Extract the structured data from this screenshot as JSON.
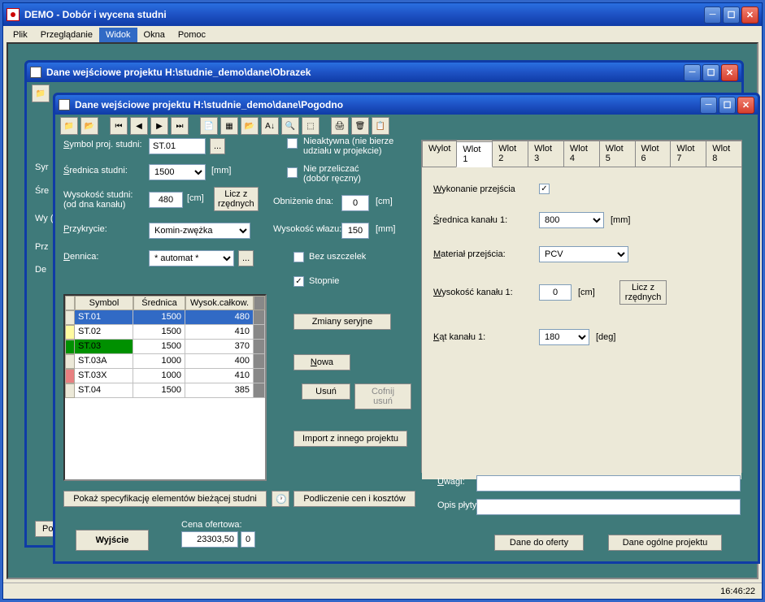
{
  "app": {
    "title": "DEMO - Dobór i wycena studni",
    "statusTime": "16:46:22"
  },
  "menu": [
    "Plik",
    "Przeglądanie",
    "Widok",
    "Okna",
    "Pomoc"
  ],
  "backWindow": {
    "title": "Dane wejściowe projektu H:\\studnie_demo\\dane\\Obrazek",
    "peekLabels": [
      "Syr",
      "Śre",
      "Wy\n(od",
      "Prz",
      "De"
    ]
  },
  "frontWindow": {
    "title": "Dane wejściowe projektu H:\\studnie_demo\\dane\\Pogodno"
  },
  "form": {
    "symbolLabel": "Symbol proj. studni:",
    "symbolValue": "ST.01",
    "srednicaLabel": "Średnica studni:",
    "srednicaValue": "1500",
    "srednicaUnit": "[mm]",
    "wysokoscLabel": "Wysokość studni:\n(od dna kanału)",
    "wysokoscValue": "480",
    "wysokoscUnit": "[cm]",
    "liczBtn": "Licz z\nrzędnych",
    "przykrycieLabel": "Przykrycie:",
    "przykrycieValue": "Komin-zwężka",
    "dennicaLabel": "Dennica:",
    "dennicaValue": "* automat *",
    "nieaktywnaLabel": "Nieaktywna (nie bierze\nudziału w projekcie)",
    "niePrzeliczacLabel": "Nie przeliczać\n(dobór ręczny)",
    "obnizenieLabel": "Obniżenie dna:",
    "obnizenieValue": "0",
    "obnizenieUnit": "[cm]",
    "wysokoscWlazuLabel": "Wysokość włazu:",
    "wysokoscWlazuValue": "150",
    "wysokoscWlazuUnit": "[mm]",
    "bezUszczelekLabel": "Bez uszczelek",
    "stopnieLabel": "Stopnie",
    "zmianyBtn": "Zmiany seryjne",
    "nowaBtn": "Nowa",
    "usunBtn": "Usuń",
    "cofnijBtn": "Cofnij usuń",
    "importBtn": "Import z innego projektu",
    "pokazBtn": "Pokaż specyfikację elementów bieżącej studni",
    "podliczenieBtn": "Podliczenie cen i kosztów",
    "wyjscieBtn": "Wyjście",
    "cenaLabel": "Cena ofertowa:",
    "cenaValue": "23303,50",
    "cenaExtra": "0",
    "uwagiLabel": "Uwagi:",
    "opisLabel": "Opis płyty:",
    "daneOfertyBtn": "Dane do oferty",
    "daneOgolneBtn": "Dane ogólne projektu"
  },
  "grid": {
    "headers": [
      "Symbol",
      "Średnica",
      "Wysok.całkow."
    ],
    "rows": [
      {
        "symbol": "ST.01",
        "srednica": "1500",
        "wysok": "480",
        "color": "#316ac5",
        "mark": "#ece9d8",
        "txt": "#fff"
      },
      {
        "symbol": "ST.02",
        "srednica": "1500",
        "wysok": "410",
        "color": "#fff",
        "mark": "#fffba0",
        "txt": "#000"
      },
      {
        "symbol": "ST.03",
        "srednica": "1500",
        "wysok": "370",
        "color": "#fff",
        "mark": "#009000",
        "txt": "#000",
        "symColor": "#009000"
      },
      {
        "symbol": "ST.03A",
        "srednica": "1000",
        "wysok": "400",
        "color": "#fff",
        "mark": "#ece9d8",
        "txt": "#000"
      },
      {
        "symbol": "ST.03X",
        "srednica": "1000",
        "wysok": "410",
        "color": "#fff",
        "mark": "#e88080",
        "txt": "#000"
      },
      {
        "symbol": "ST.04",
        "srednica": "1500",
        "wysok": "385",
        "color": "#fff",
        "mark": "#ece9d8",
        "txt": "#000"
      }
    ]
  },
  "tabs": {
    "names": [
      "Wylot",
      "Wlot 1",
      "Wlot 2",
      "Wlot 3",
      "Wlot 4",
      "Wlot 5",
      "Wlot 6",
      "Wlot 7",
      "Wlot 8"
    ],
    "active": 1,
    "body": {
      "wykonanieLabel": "Wykonanie przejścia",
      "wykonanieChecked": true,
      "srednicaLabel": "Średnica kanału 1:",
      "srednicaValue": "800",
      "srednicaUnit": "[mm]",
      "materialLabel": "Materiał przejścia:",
      "materialValue": "PCV",
      "wysokoscLabel": "Wysokość kanału 1:",
      "wysokoscValue": "0",
      "wysokoscUnit": "[cm]",
      "liczBtn": "Licz z\nrzędnych",
      "katLabel": "Kąt kanału 1:",
      "katValue": "180",
      "katUnit": "[deg]"
    }
  }
}
